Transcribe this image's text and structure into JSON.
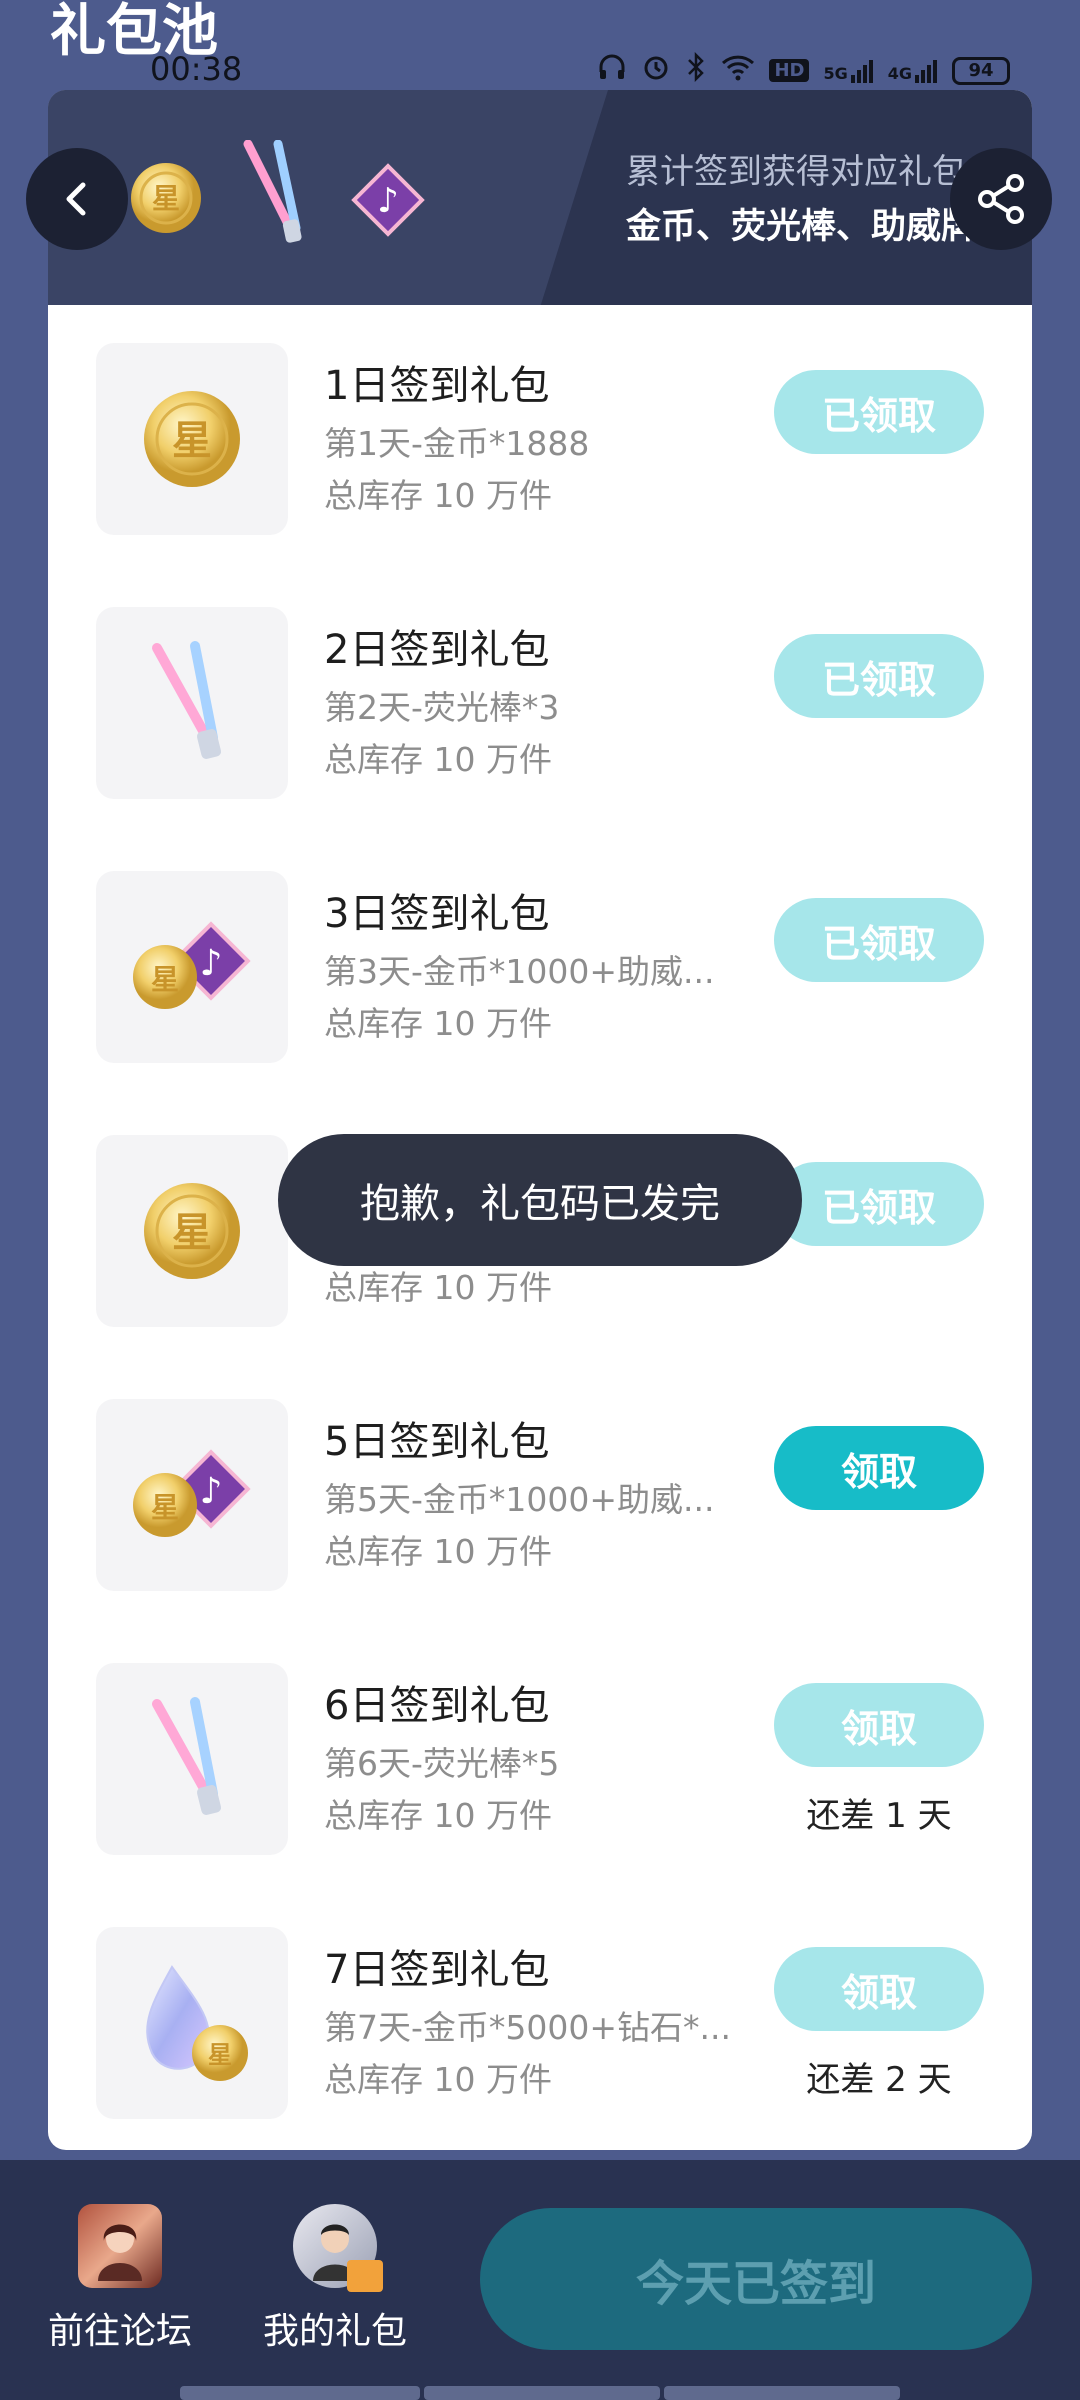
{
  "page_title": "礼包池",
  "status_bar": {
    "time": "00:38",
    "battery": "94",
    "hd": "HD",
    "net1": "5G",
    "net2": "4G"
  },
  "header": {
    "line1": "累计签到获得对应礼包",
    "line2": "金币、荧光棒、助威牌"
  },
  "gifts": [
    {
      "title": "1日签到礼包",
      "desc": "第1天-金币*1888",
      "stock": "总库存 10 万件",
      "button": "已领取",
      "state": "claimed",
      "note": "",
      "icon": "gold-coin-icon"
    },
    {
      "title": "2日签到礼包",
      "desc": "第2天-荧光棒*3",
      "stock": "总库存 10 万件",
      "button": "已领取",
      "state": "claimed",
      "note": "",
      "icon": "glow-stick-icon"
    },
    {
      "title": "3日签到礼包",
      "desc": "第3天-金币*1000+助威...",
      "stock": "总库存 10 万件",
      "button": "已领取",
      "state": "claimed",
      "note": "",
      "icon": "coin-and-cheer-badge-icon"
    },
    {
      "title": "",
      "desc": "",
      "stock": "总库存 10 万件",
      "button": "已领取",
      "state": "claimed",
      "note": "",
      "icon": "gold-coin-icon"
    },
    {
      "title": "5日签到礼包",
      "desc": "第5天-金币*1000+助威...",
      "stock": "总库存 10 万件",
      "button": "领取",
      "state": "active",
      "note": "",
      "icon": "coin-and-cheer-badge-icon"
    },
    {
      "title": "6日签到礼包",
      "desc": "第6天-荧光棒*5",
      "stock": "总库存 10 万件",
      "button": "领取",
      "state": "pending",
      "note": "还差 1 天",
      "icon": "glow-stick-icon"
    },
    {
      "title": "7日签到礼包",
      "desc": "第7天-金币*5000+钻石*...",
      "stock": "总库存 10 万件",
      "button": "领取",
      "state": "pending",
      "note": "还差 2 天",
      "icon": "diamond-and-coin-icon"
    }
  ],
  "toast": "抱歉，礼包码已发完",
  "bottom_nav": {
    "forum_label": "前往论坛",
    "my_gifts_label": "我的礼包",
    "sign_button": "今天已签到"
  },
  "colors": {
    "background": "#4d5b8d",
    "header_bg": "#2c3450",
    "claimed_btn": "#a6e6ea",
    "active_btn": "#17bcc8",
    "sign_btn": "#1d6a7e"
  }
}
